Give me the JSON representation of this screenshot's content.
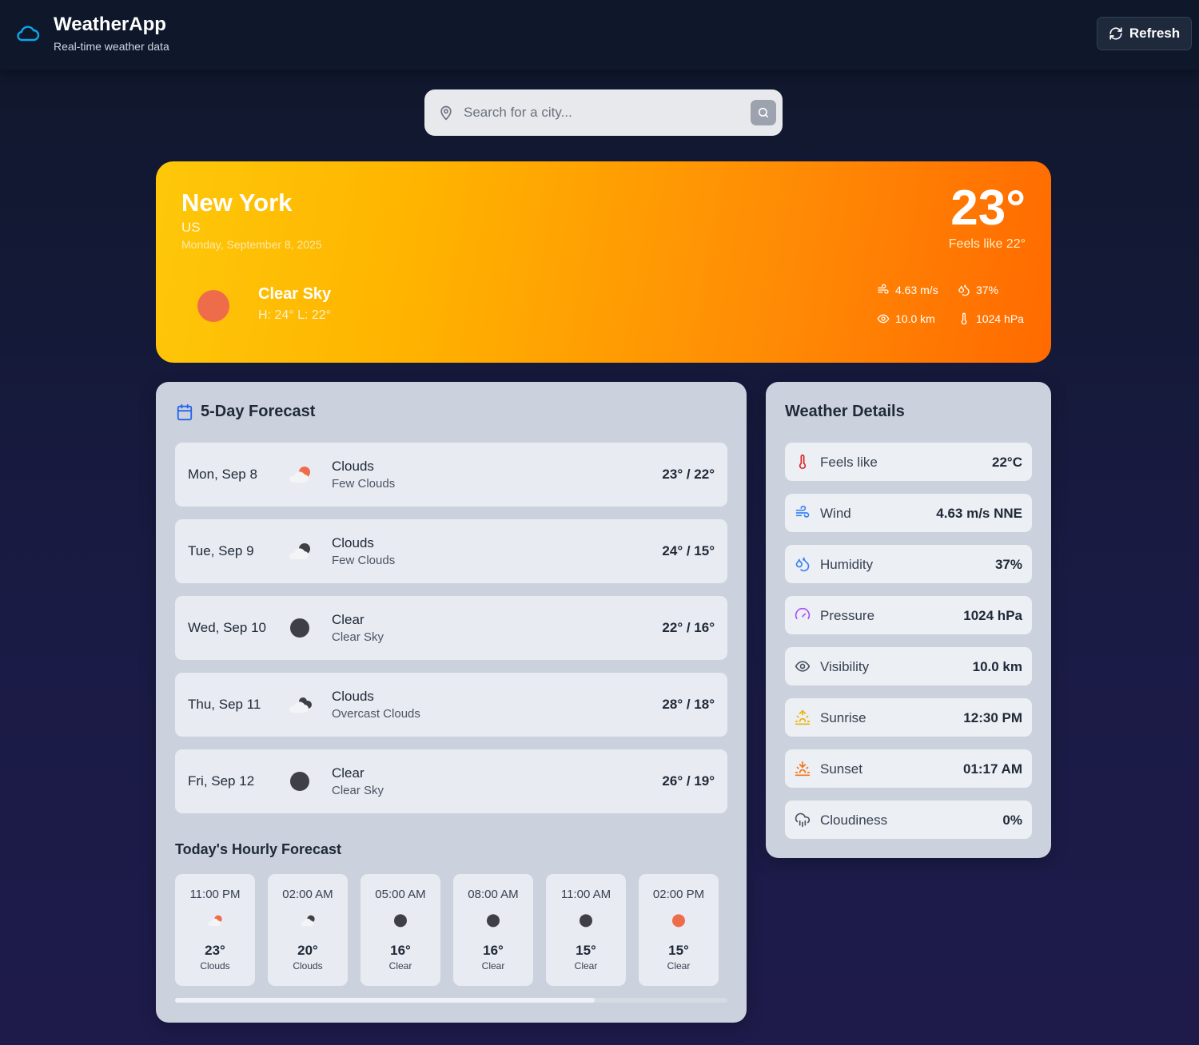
{
  "header": {
    "title": "WeatherApp",
    "subtitle": "Real-time weather data",
    "refresh_label": "Refresh"
  },
  "search": {
    "placeholder": "Search for a city..."
  },
  "current": {
    "city": "New York",
    "country": "US",
    "date": "Monday, September 8, 2025",
    "temp": "23°",
    "feels_like": "Feels like 22°",
    "condition": "Clear Sky",
    "hilo": "H: 24° L: 22°",
    "wind": "4.63 m/s",
    "humidity": "37%",
    "visibility": "10.0 km",
    "pressure": "1024 hPa"
  },
  "forecast": {
    "title": "5-Day Forecast",
    "days": [
      {
        "day": "Mon, Sep 8",
        "icon": "partly-cloudy-day-icon",
        "main": "Clouds",
        "desc": "Few Clouds",
        "temp": "23° / 22°"
      },
      {
        "day": "Tue, Sep 9",
        "icon": "partly-cloudy-night-icon",
        "main": "Clouds",
        "desc": "Few Clouds",
        "temp": "24° / 15°"
      },
      {
        "day": "Wed, Sep 10",
        "icon": "clear-night-icon",
        "main": "Clear",
        "desc": "Clear Sky",
        "temp": "22° / 16°"
      },
      {
        "day": "Thu, Sep 11",
        "icon": "overcast-clouds-icon",
        "main": "Clouds",
        "desc": "Overcast Clouds",
        "temp": "28° / 18°"
      },
      {
        "day": "Fri, Sep 12",
        "icon": "clear-night-icon",
        "main": "Clear",
        "desc": "Clear Sky",
        "temp": "26° / 19°"
      }
    ]
  },
  "hourly": {
    "title": "Today's Hourly Forecast",
    "scroll_progress": 0.76,
    "hours": [
      {
        "time": "11:00 PM",
        "icon": "partly-cloudy-day-icon",
        "temp": "23°",
        "cond": "Clouds"
      },
      {
        "time": "02:00 AM",
        "icon": "partly-cloudy-night-icon",
        "temp": "20°",
        "cond": "Clouds"
      },
      {
        "time": "05:00 AM",
        "icon": "clear-night-icon",
        "temp": "16°",
        "cond": "Clear"
      },
      {
        "time": "08:00 AM",
        "icon": "clear-night-icon",
        "temp": "16°",
        "cond": "Clear"
      },
      {
        "time": "11:00 AM",
        "icon": "clear-night-icon",
        "temp": "15°",
        "cond": "Clear"
      },
      {
        "time": "02:00 PM",
        "icon": "clear-day-icon",
        "temp": "15°",
        "cond": "Clear"
      }
    ]
  },
  "details": {
    "title": "Weather Details",
    "items": [
      {
        "label": "Feels like",
        "value": "22°C",
        "icon": "thermometer-icon"
      },
      {
        "label": "Wind",
        "value": "4.63 m/s NNE",
        "icon": "wind-icon"
      },
      {
        "label": "Humidity",
        "value": "37%",
        "icon": "droplets-icon"
      },
      {
        "label": "Pressure",
        "value": "1024 hPa",
        "icon": "gauge-icon"
      },
      {
        "label": "Visibility",
        "value": "10.0 km",
        "icon": "eye-icon"
      },
      {
        "label": "Sunrise",
        "value": "12:30 PM",
        "icon": "sunrise-icon"
      },
      {
        "label": "Sunset",
        "value": "01:17 AM",
        "icon": "sunset-icon"
      },
      {
        "label": "Cloudiness",
        "value": "0%",
        "icon": "cloud-rain-icon"
      }
    ]
  },
  "colors": {
    "accent_blue": "#0ea5e9",
    "hero_start": "#fec809",
    "hero_end": "#ff6a00",
    "sun": "#ef6c4a",
    "moon": "#3f3f46"
  }
}
